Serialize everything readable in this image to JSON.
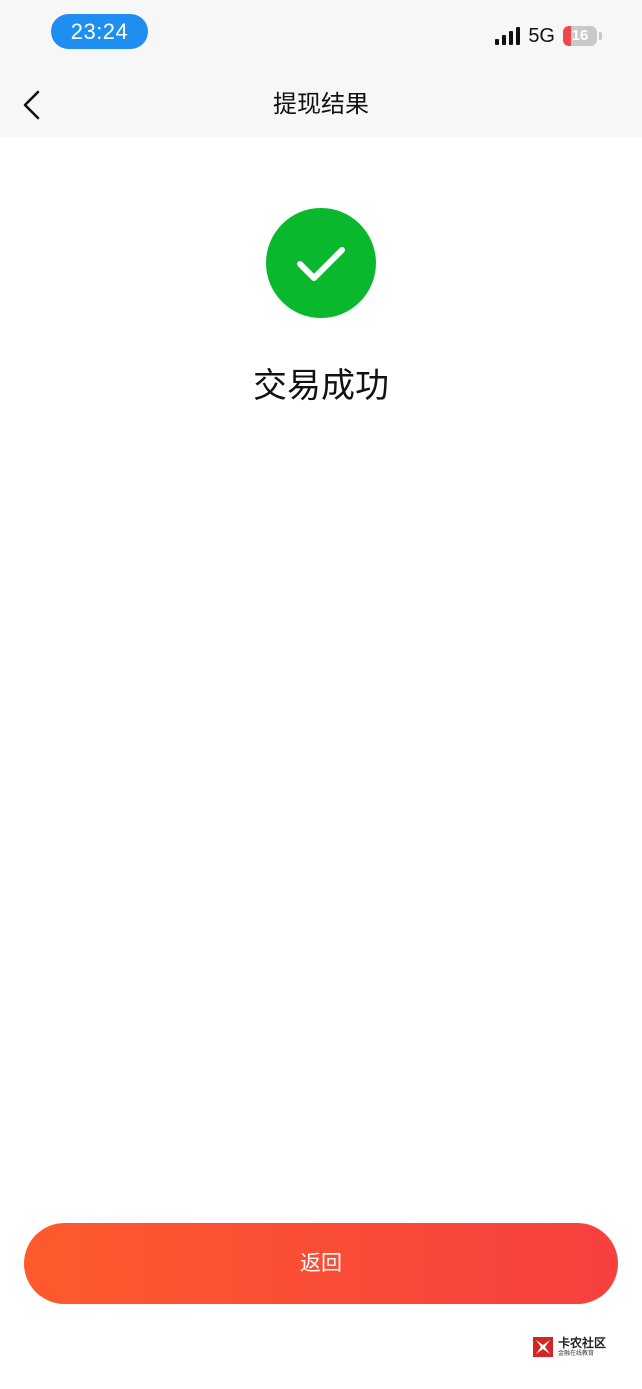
{
  "status_bar": {
    "time": "23:24",
    "network": "5G",
    "battery": "16",
    "battery_level_pct": 16
  },
  "nav": {
    "title": "提现结果",
    "back_icon": "chevron-left-icon"
  },
  "result": {
    "icon": "check-circle-icon",
    "message": "交易成功"
  },
  "actions": {
    "return_label": "返回"
  },
  "watermark": {
    "title": "卡农社区",
    "subtitle": "金融在线教育"
  },
  "colors": {
    "success_green": "#09b82c",
    "button_start": "#fe5a2c",
    "button_end": "#f74040",
    "time_pill": "#1e8ef0",
    "header_bg": "#f7f7f7"
  }
}
